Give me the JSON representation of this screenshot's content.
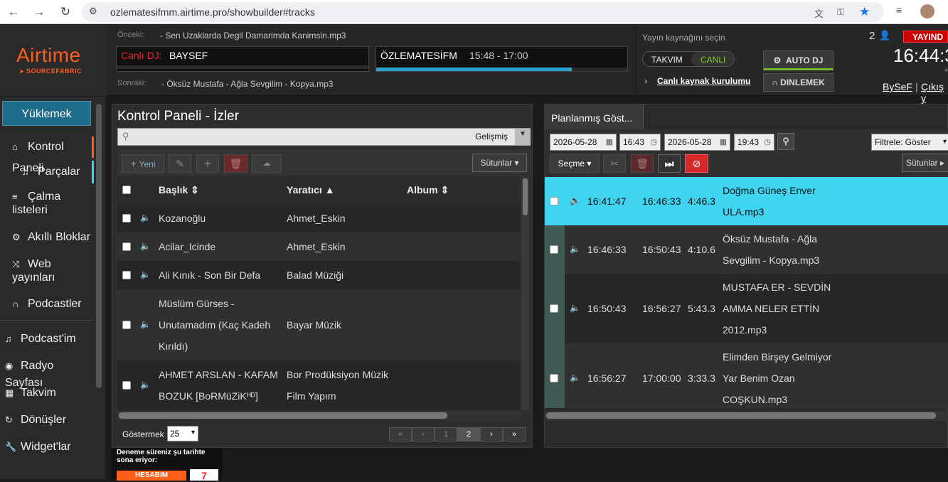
{
  "browser": {
    "url": "ozlematesifmm.airtime.pro/showbuilder#tracks"
  },
  "logo": {
    "title": "Airtime",
    "subtitle": "SOURCEFABRIC"
  },
  "player": {
    "previous_label": "Önceki:",
    "previous_track": "- Sen Uzaklarda Degil Damarimda Kanimsin.mp3",
    "live_label": "Canlı DJ:",
    "live_name": "BAYSEF",
    "show_name": "ÖZLEMATESİFM",
    "show_time": "15:48 - 17:00",
    "show_progress": 0.78,
    "next_label": "Sonraki:",
    "next_track": "- Öksüz Mustafa - Ağla Sevgilim - Kopya.mp3"
  },
  "source": {
    "label": "Yayın kaynağını seçin",
    "scheduled": "TAKVIM",
    "live": "CANLI",
    "settings": "Canlı kaynak kurulumu",
    "auto_dj": "AUTO DJ",
    "listen": "DINLEMEK"
  },
  "status": {
    "listeners": "2",
    "on_air": "YAYIND",
    "clock": "16:44:3",
    "clock_suffix": "+",
    "user": "BySeF",
    "separator": "|",
    "logout": "Çıkış y"
  },
  "sidebar": {
    "upload": "Yüklemek",
    "items": [
      {
        "label": "Kontrol Paneli",
        "icon": "home-icon"
      },
      {
        "label": "Parçalar",
        "icon": "music-icon"
      },
      {
        "label": "Çalma listeleri",
        "icon": "list-icon"
      },
      {
        "label": "Akıllı Bloklar",
        "icon": "settings-icon"
      },
      {
        "label": "Web yayınları",
        "icon": "shuffle-icon"
      },
      {
        "label": "Podcastler",
        "icon": "headphones-icon"
      },
      {
        "label": "Podcast'im",
        "icon": "music-icon"
      },
      {
        "label": "Radyo Sayfası",
        "icon": "globe-icon"
      },
      {
        "label": "Takvim",
        "icon": "calendar-icon"
      },
      {
        "label": "Dönüşler",
        "icon": "refresh-icon"
      },
      {
        "label": "Widget'lar",
        "icon": "wrench-icon"
      }
    ],
    "trial_text": "Deneme süreniz şu tarihte sona eriyor:",
    "account_button": "HESABIM",
    "days_left": "7"
  },
  "library": {
    "title": "Kontrol Paneli - İzler",
    "advanced": "Gelişmiş",
    "new_button": "Yeni",
    "columns_button": "Sütunlar",
    "headers": {
      "title": "Başlık",
      "creator": "Yaratıcı",
      "album": "Album"
    },
    "rows": [
      {
        "lines": [
          "Kozanoğlu"
        ],
        "creator": [
          "Ahmet_Eskin"
        ]
      },
      {
        "lines": [
          "Acilar_Icinde"
        ],
        "creator": [
          "Ahmet_Eskin"
        ]
      },
      {
        "lines": [
          "Ali Kınık - Son Bir Defa"
        ],
        "creator": [
          "Balad Müziği"
        ]
      },
      {
        "lines": [
          "Müslüm Gürses -",
          "Unutamadım (Kaç Kadeh",
          "Kırıldı)"
        ],
        "creator": [
          "Bayar Müzik"
        ]
      },
      {
        "lines": [
          "AHMET ARSLAN - KAFAM",
          "BOZUK [BoRMüZiKᴴᴰ]"
        ],
        "creator": [
          "Bor Prodüksiyon Müzik",
          "Film Yapım"
        ]
      }
    ],
    "show_label": "Göstermek",
    "show_value": "25",
    "pagination": [
      "«",
      "‹",
      "1",
      "2",
      "›",
      "»"
    ]
  },
  "schedule": {
    "tab": "Planlanmış Göst...",
    "from_date": "2026-05-28",
    "from_time": "16:43",
    "to_date": "2026-05-28",
    "to_time": "19:43",
    "filter": "Filtrele: Göster",
    "select_button": "Seçme",
    "columns_button": "Sütunlar",
    "rows": [
      {
        "start": "16:41:47",
        "end": "16:46:33",
        "length": "4:46.3",
        "lines": [
          "Doğma Güneş Enver",
          "ULA.mp3"
        ],
        "active": true
      },
      {
        "start": "16:46:33",
        "end": "16:50:43",
        "length": "4:10.6",
        "lines": [
          "Öksüz Mustafa - Ağla",
          "Sevgilim - Kopya.mp3"
        ],
        "active": false
      },
      {
        "start": "16:50:43",
        "end": "16:56:27",
        "length": "5:43.3",
        "lines": [
          "MUSTAFA ER - SEVDİN",
          "AMMA NELER ETTİN",
          "2012.mp3"
        ],
        "active": false
      },
      {
        "start": "16:56:27",
        "end": "17:00:00",
        "length": "3:33.3",
        "lines": [
          "Elimden Birşey Gelmiyor",
          "Yar Benim Ozan",
          "COŞKUN.mp3"
        ],
        "active": false
      }
    ]
  },
  "colors": {
    "accent": "#ff5d1a",
    "active_row": "#3fd5f0",
    "upload": "#1f6b8a"
  }
}
